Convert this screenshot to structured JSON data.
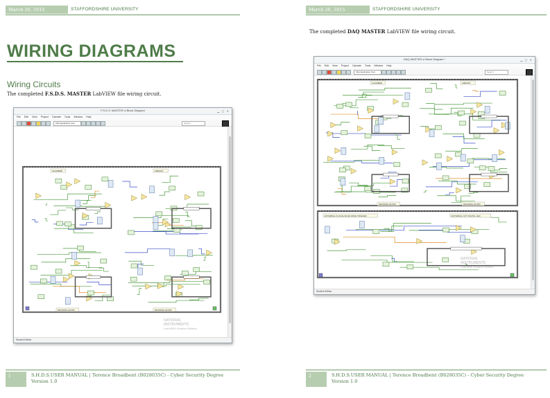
{
  "header": {
    "date": "March 26, 2015",
    "university": "STAFFORDSHIRE UNIVERSITY"
  },
  "page1": {
    "title": "WIRING DIAGRAMS",
    "subtitle": "Wiring Circuits",
    "caption_prefix": "The completed ",
    "caption_bold": "F.S.D.S. MASTER",
    "caption_suffix": " LabVIEW file wiring circuit.",
    "window": {
      "title": "F.S.D.S. MASTER.vi Block Diagram",
      "font_select": "15pt Application Font",
      "search_placeholder": "Search",
      "status": "Student Edition",
      "labels": [
        "CHAMBER",
        "LIBRARY",
        "DRAWING ROOM",
        "DRAWING ROOM"
      ],
      "watermark": [
        "NATIONAL",
        "INSTRUMENTS",
        "LabVIEW Student Edition"
      ]
    },
    "footer_num": "1",
    "footer_text": "S.H.D.S.USER MANUAL | Terence Broadbent (B028035C) - Cyber Security Degree Version 1.0"
  },
  "page2": {
    "caption_prefix": "The completed ",
    "caption_bold": "DAQ MASTER",
    "caption_suffix": " LabVIEW file wiring circuit.",
    "window": {
      "title": "DAQ MASTER.vi Block Diagram *",
      "font_select": "15pt Application Font",
      "search_placeholder": "Search",
      "status": "Student Edition",
      "labels": [
        "CHAMBER",
        "LIBRARY",
        "DRAWING ROOM",
        "DRAWING ROOM",
        "EXTERNAL IN ANALOGUE WAVE TRIGGER",
        "EXTERNAL OUT DIGITAL LED"
      ],
      "watermark": [
        "NATIONAL",
        "INSTRUMENTS",
        "LabVIEW Student Edition"
      ]
    },
    "footer_num": "2",
    "footer_text": "S.H.D.S.USER MANUAL | Terence Broadbent (B028035C) - Cyber Security Degree Version 1.0"
  },
  "menu": [
    "File",
    "Edit",
    "View",
    "Project",
    "Operate",
    "Tools",
    "Window",
    "Help"
  ],
  "colors": {
    "accent": "#4f7c49",
    "header_box": "#b7cdb0",
    "wire_green": "#4a9a3c",
    "wire_blue": "#3b4fc8",
    "wire_orange": "#e08a2a"
  }
}
